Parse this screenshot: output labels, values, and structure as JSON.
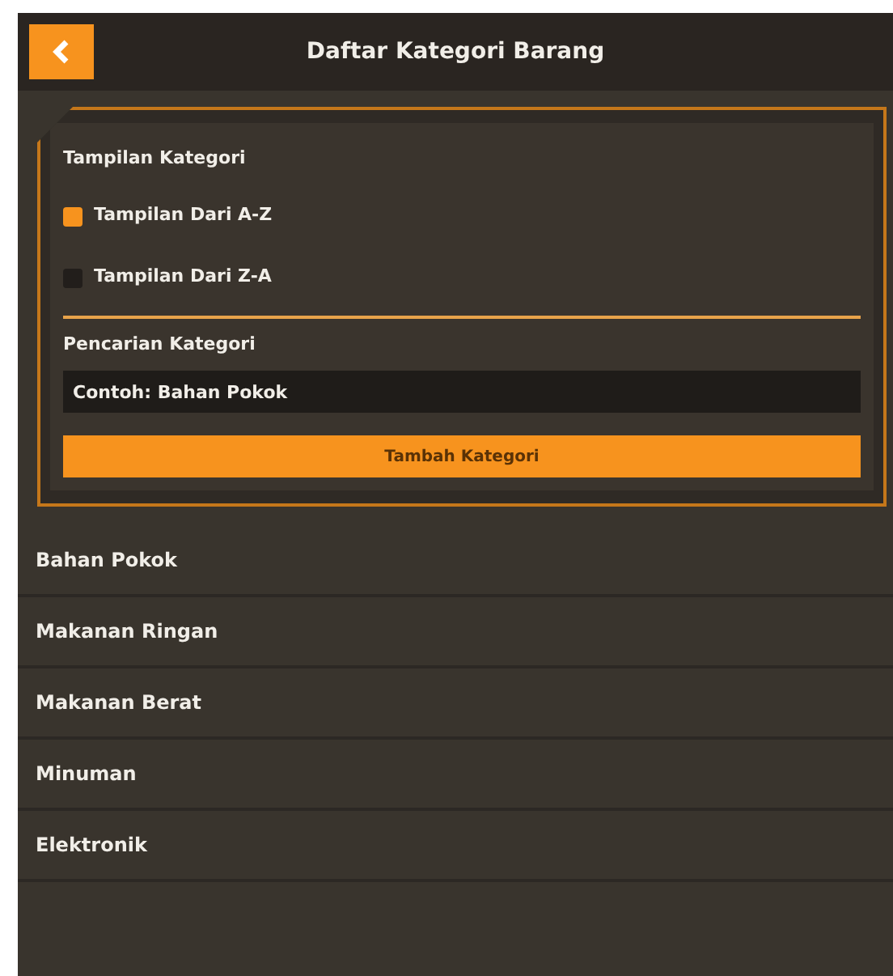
{
  "header": {
    "title": "Daftar Kategori Barang"
  },
  "display": {
    "label": "Tampilan Kategori",
    "options": [
      {
        "label": "Tampilan Dari A-Z",
        "selected": true
      },
      {
        "label": "Tampilan Dari Z-A",
        "selected": false
      }
    ]
  },
  "search": {
    "label": "Pencarian Kategori",
    "placeholder": "Contoh: Bahan Pokok"
  },
  "add_button": "Tambah Kategori",
  "categories": [
    {
      "name": "Bahan Pokok"
    },
    {
      "name": "Makanan Ringan"
    },
    {
      "name": "Makanan Berat"
    },
    {
      "name": "Minuman"
    },
    {
      "name": "Elektronik"
    }
  ]
}
